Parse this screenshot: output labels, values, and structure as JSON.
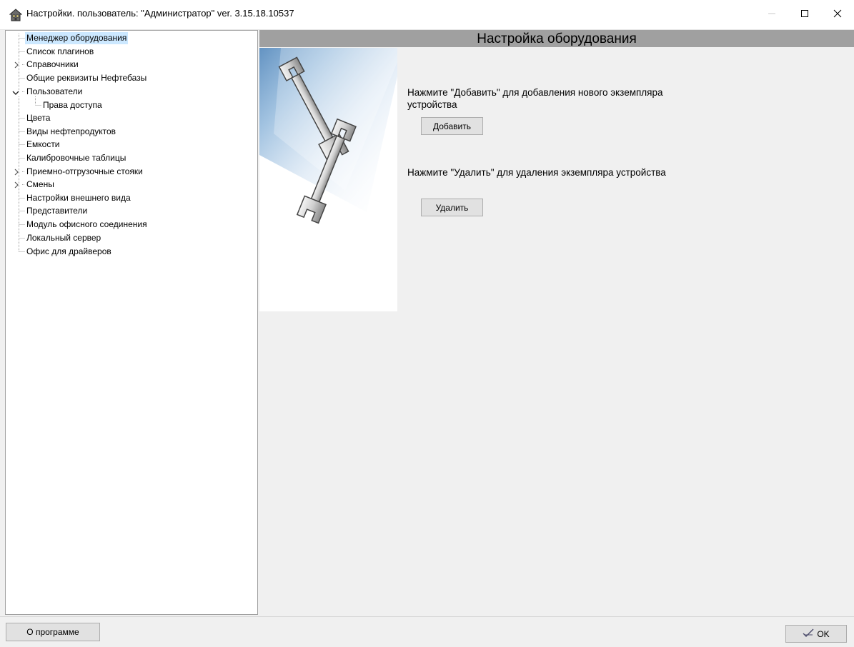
{
  "window": {
    "title": "Настройки. пользователь: \"Администратор\" ver. 3.15.18.10537",
    "app_icon": "house-icon",
    "controls": [
      "minimize-icon",
      "maximize-icon",
      "close-icon"
    ]
  },
  "tree": {
    "items": [
      {
        "label": "Менеджер оборудования",
        "selected": true
      },
      {
        "label": "Список плагинов"
      },
      {
        "label": "Справочники",
        "expander": "collapsed"
      },
      {
        "label": "Общие реквизиты Нефтебазы"
      },
      {
        "label": "Пользователи",
        "expander": "expanded"
      },
      {
        "label": "Права доступа",
        "child": true
      },
      {
        "label": "Цвета"
      },
      {
        "label": "Виды нефтепродуктов"
      },
      {
        "label": "Емкости"
      },
      {
        "label": "Калибровочные таблицы"
      },
      {
        "label": "Приемно-отгрузочные стояки",
        "expander": "collapsed"
      },
      {
        "label": "Смены",
        "expander": "collapsed"
      },
      {
        "label": "Настройки внешнего вида"
      },
      {
        "label": "Представители"
      },
      {
        "label": "Модуль офисного соединения"
      },
      {
        "label": "Локальный сервер"
      },
      {
        "label": "Офис для драйверов"
      }
    ]
  },
  "main": {
    "header": "Настройка оборудования",
    "illustration_icon": "wrenches-icon",
    "add_text": "Нажмите \"Добавить\" для добавления нового экземпляра устройства",
    "add_button": "Добавить",
    "delete_text": "Нажмите \"Удалить\" для удаления экземпляра устройства",
    "delete_button": "Удалить"
  },
  "footer": {
    "about_button": "О программе",
    "ok_button": "OK",
    "ok_icon": "checkmark-icon"
  },
  "colors": {
    "selection": "#cce8ff",
    "header_bar": "#a0a0a0",
    "background": "#f0f0f0"
  }
}
